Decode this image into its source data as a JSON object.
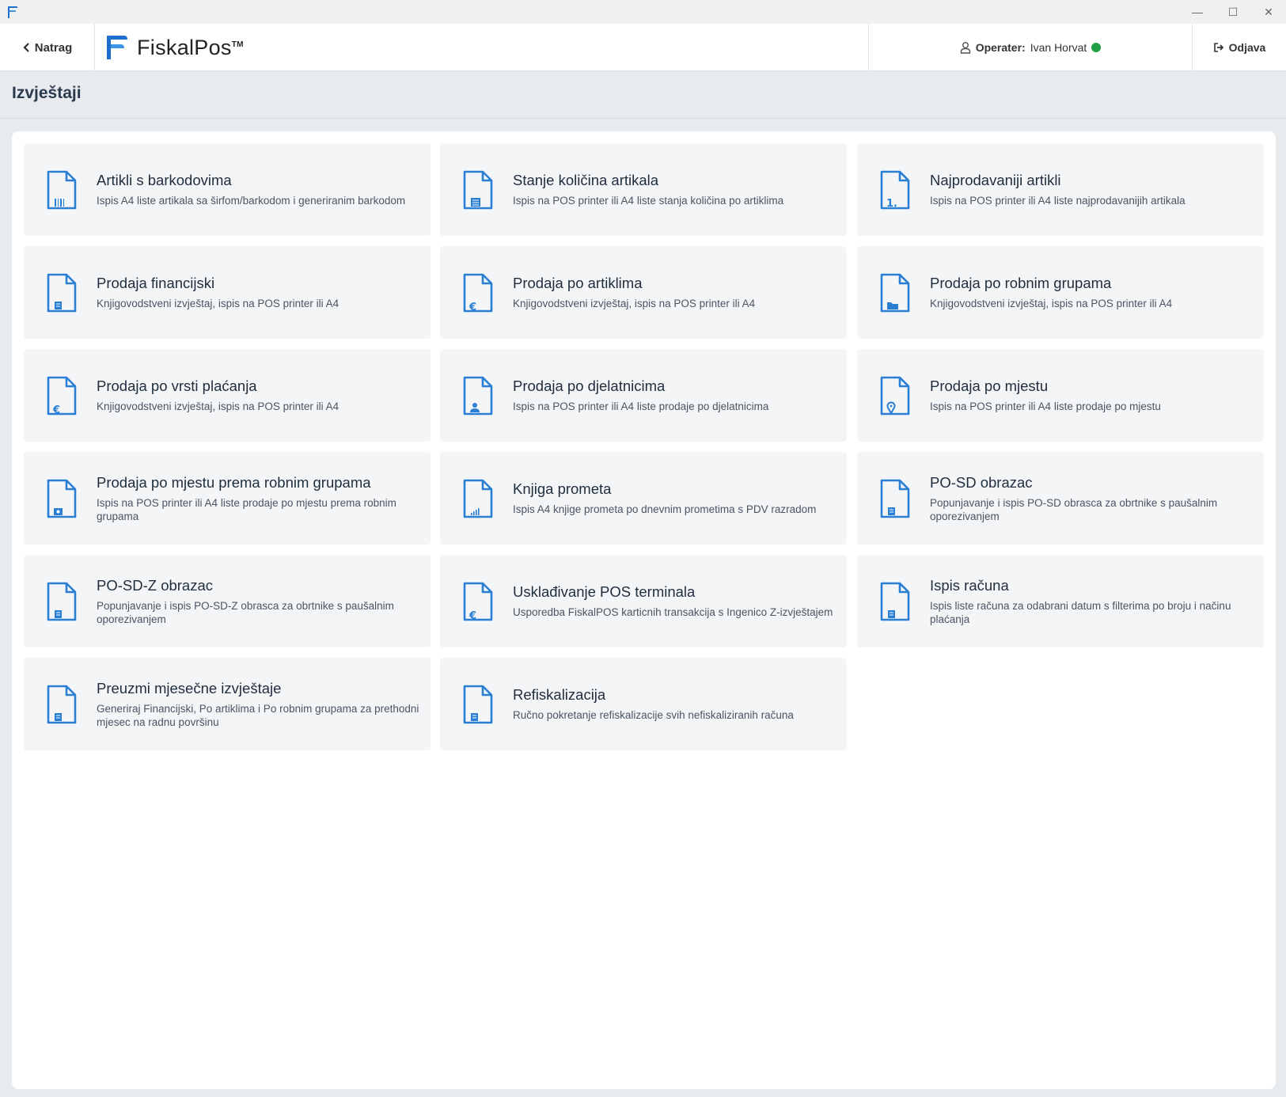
{
  "window": {
    "min_symbol": "—",
    "max_symbol": "☐",
    "close_symbol": "✕"
  },
  "header": {
    "back_label": "Natrag",
    "logo_text": "FiskalPos",
    "logo_tm": "TM",
    "operator_label": "Operater:",
    "operator_name": "Ivan Horvat",
    "logout_label": "Odjava"
  },
  "page": {
    "title": "Izvještaji"
  },
  "colors": {
    "accent": "#2a7fd4",
    "online": "#22a046"
  },
  "reports": [
    {
      "title": "Artikli s barkodovima",
      "desc": "Ispis A4 liste artikala sa širfom/barkodom i generiranim barkodom",
      "icon": "barcode-document-icon"
    },
    {
      "title": "Stanje količina artikala",
      "desc": "Ispis na POS printer ili A4 liste stanja količina po artiklima",
      "icon": "list-document-icon"
    },
    {
      "title": "Najprodavaniji artikli",
      "desc": "Ispis na POS printer ili A4 liste najprodavanijih artikala",
      "icon": "ranked-document-icon"
    },
    {
      "title": "Prodaja financijski",
      "desc": "Knjigovodstveni izvještaj, ispis na POS printer ili A4",
      "icon": "finance-document-icon"
    },
    {
      "title": "Prodaja po artiklima",
      "desc": "Knjigovodstveni izvještaj, ispis na POS printer ili A4",
      "icon": "euro-document-icon"
    },
    {
      "title": "Prodaja po robnim grupama",
      "desc": "Knjigovodstveni izvještaj, ispis na POS printer ili A4",
      "icon": "folder-document-icon"
    },
    {
      "title": "Prodaja po vrsti plaćanja",
      "desc": "Knjigovodstveni izvještaj, ispis na POS printer ili A4",
      "icon": "euro-document-icon"
    },
    {
      "title": "Prodaja po djelatnicima",
      "desc": "Ispis na POS printer ili A4 liste prodaje po djelatnicima",
      "icon": "user-document-icon"
    },
    {
      "title": "Prodaja po mjestu",
      "desc": "Ispis na POS printer ili A4 liste prodaje po mjestu",
      "icon": "location-document-icon"
    },
    {
      "title": "Prodaja po mjestu prema robnim grupama",
      "desc": "Ispis na POS printer ili A4 liste prodaje po mjestu prema robnim grupama",
      "icon": "location-group-document-icon"
    },
    {
      "title": "Knjiga prometa",
      "desc": "Ispis A4 knjige prometa po dnevnim prometima s PDV razradom",
      "icon": "chart-document-icon"
    },
    {
      "title": "PO-SD obrazac",
      "desc": "Popunjavanje i ispis PO-SD obrasca za obrtnike s paušalnim oporezivanjem",
      "icon": "form-document-icon"
    },
    {
      "title": "PO-SD-Z obrazac",
      "desc": "Popunjavanje i ispis PO-SD-Z obrasca za obrtnike s paušalnim oporezivanjem",
      "icon": "form-document-icon"
    },
    {
      "title": "Usklađivanje POS terminala",
      "desc": "Usporedba FiskalPOS karticnih transakcija s Ingenico Z-izvještajem",
      "icon": "euro-document-icon"
    },
    {
      "title": "Ispis računa",
      "desc": "Ispis liste računa za odabrani datum s filterima po broju i načinu plaćanja",
      "icon": "receipt-document-icon"
    },
    {
      "title": "Preuzmi mjesečne izvještaje",
      "desc": "Generiraj Financijski, Po artiklima i Po robnim grupama za prethodni mjesec na radnu površinu",
      "icon": "download-document-icon"
    },
    {
      "title": "Refiskalizacija",
      "desc": "Ručno pokretanje refiskalizacije svih nefiskaliziranih računa",
      "icon": "receipt-document-icon"
    }
  ]
}
